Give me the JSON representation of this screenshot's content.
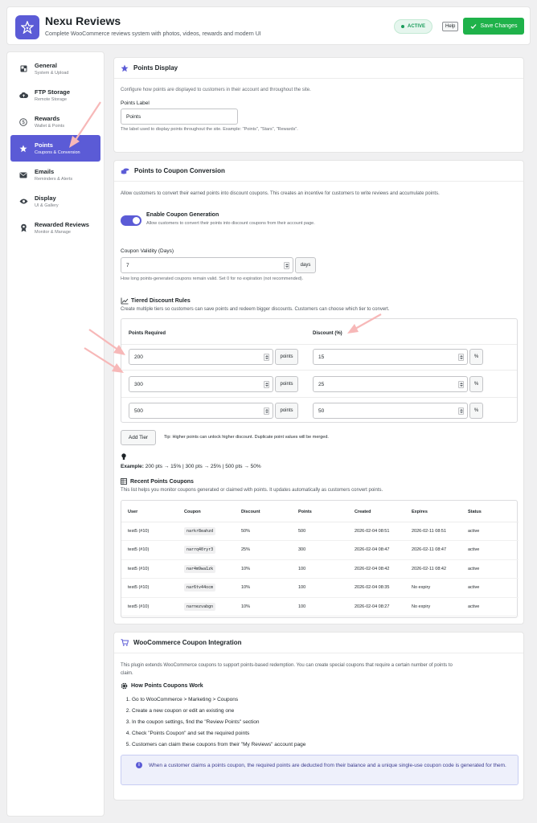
{
  "header": {
    "title": "Nexu Reviews",
    "subtitle": "Complete WooCommerce reviews system with photos, videos, rewards and modern UI",
    "status": "ACTIVE",
    "help": "Help",
    "save": "Save Changes"
  },
  "sidebar": {
    "items": [
      {
        "label": "General",
        "sub": "System & Upload",
        "icon": "dashboard-icon"
      },
      {
        "label": "FTP Storage",
        "sub": "Remote Storage",
        "icon": "cloud-upload-icon"
      },
      {
        "label": "Rewards",
        "sub": "Wallet & Points",
        "icon": "dollar-icon"
      },
      {
        "label": "Points",
        "sub": "Coupons & Conversion",
        "icon": "star-icon"
      },
      {
        "label": "Emails",
        "sub": "Reminders & Alerts",
        "icon": "email-icon"
      },
      {
        "label": "Display",
        "sub": "UI & Gallery",
        "icon": "eye-icon"
      },
      {
        "label": "Rewarded Reviews",
        "sub": "Monitor & Manage",
        "icon": "award-icon"
      }
    ]
  },
  "points_display": {
    "title": "Points Display",
    "desc": "Configure how points are displayed to customers in their account and throughout the site.",
    "label": "Points Label",
    "value": "Points",
    "help": "The label used to display points throughout the site. Example: \"Points\", \"Stars\", \"Rewards\"."
  },
  "conversion": {
    "title": "Points to Coupon Conversion",
    "desc": "Allow customers to convert their earned points into discount coupons. This creates an incentive for customers to write reviews and accumulate points.",
    "enable_title": "Enable Coupon Generation",
    "enable_desc": "Allow customers to convert their points into discount coupons from their account page.",
    "validity_label": "Coupon Validity (Days)",
    "validity_value": "7",
    "validity_unit": "days",
    "validity_help": "How long points-generated coupons remain valid. Set 0 for no expiration (not recommended).",
    "tiers_title": "Tiered Discount Rules",
    "tiers_desc": "Create multiple tiers so customers can save points and redeem bigger discounts. Customers can choose which tier to convert.",
    "col_points": "Points Required",
    "col_discount": "Discount (%)",
    "points_unit": "points",
    "percent_unit": "%",
    "tiers": [
      {
        "points": "200",
        "discount": "15"
      },
      {
        "points": "300",
        "discount": "25"
      },
      {
        "points": "500",
        "discount": "50"
      }
    ],
    "add_tier": "Add Tier",
    "tip": "Tip: Higher points can unlock higher discount. Duplicate point values will be merged.",
    "example_label": "Example:",
    "example_text": "200 pts → 15% | 300 pts → 25% | 500 pts → 50%",
    "recent_title": "Recent Points Coupons",
    "recent_desc": "This list helps you monitor coupons generated or claimed with points. It updates automatically as customers convert points.",
    "table_headers": [
      "User",
      "Coupon",
      "Discount",
      "Points",
      "Created",
      "Expires",
      "Status"
    ],
    "rows": [
      [
        "test5 (#10)",
        "narkr8eahzd",
        "50%",
        "500",
        "2026-02-04 08:51",
        "2026-02-11 08:51",
        "active"
      ],
      [
        "test5 (#10)",
        "narrq40ryr3",
        "25%",
        "300",
        "2026-02-04 08:47",
        "2026-02-11 08:47",
        "active"
      ],
      [
        "test5 (#10)",
        "nar4m9wa1zk",
        "10%",
        "100",
        "2026-02-04 08:42",
        "2026-02-11 08:42",
        "active"
      ],
      [
        "test5 (#10)",
        "nar6tv44ocm",
        "10%",
        "100",
        "2026-02-04 08:35",
        "No expiry",
        "active"
      ],
      [
        "test5 (#10)",
        "narnezvabgn",
        "10%",
        "100",
        "2026-02-04 08:27",
        "No expiry",
        "active"
      ]
    ]
  },
  "woo": {
    "title": "WooCommerce Coupon Integration",
    "desc": "This plugin extends WooCommerce coupons to support points-based redemption. You can create special coupons that require a certain number of points to claim.",
    "how_title": "How Points Coupons Work",
    "steps": [
      "Go to WooCommerce > Marketing > Coupons",
      "Create a new coupon or edit an existing one",
      "In the coupon settings, find the \"Review Points\" section",
      "Check \"Points Coupon\" and set the required points",
      "Customers can claim these coupons from their \"My Reviews\" account page"
    ],
    "info": "When a customer claims a points coupon, the required points are deducted from their balance and a unique single-use coupon code is generated for them."
  },
  "colors": {
    "accent": "#5b5bd6",
    "success": "#1fb24a",
    "annotation_arrow": "#f7b8b8"
  }
}
